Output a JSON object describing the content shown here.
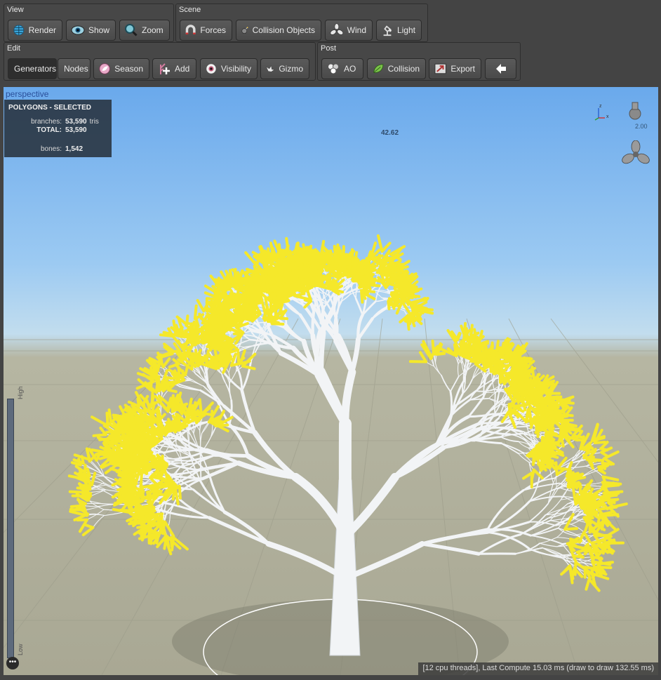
{
  "toolbar": {
    "view": {
      "title": "View",
      "render": "Render",
      "show": "Show",
      "zoom": "Zoom"
    },
    "scene": {
      "title": "Scene",
      "forces": "Forces",
      "collision_objects": "Collision Objects",
      "wind": "Wind",
      "light": "Light"
    },
    "edit": {
      "title": "Edit",
      "generators": "Generators",
      "nodes": "Nodes",
      "season": "Season",
      "add": "Add",
      "visibility": "Visibility",
      "gizmo": "Gizmo"
    },
    "post": {
      "title": "Post",
      "ao": "AO",
      "collision": "Collision",
      "export": "Export"
    }
  },
  "viewport": {
    "label": "perspective",
    "fps": "42.62",
    "zoom": "2.00",
    "axis_z": "z",
    "axis_x": "x",
    "lod_high": "High",
    "lod_low": "Low",
    "more": "•••",
    "stats": {
      "heading": "POLYGONS - SELECTED",
      "branches_label": "branches:",
      "branches_value": "53,590",
      "branches_unit": "tris",
      "total_label": "TOTAL:",
      "total_value": "53,590",
      "bones_label": "bones:",
      "bones_value": "1,542"
    },
    "status": "[12 cpu threads], Last Compute 15.03 ms (draw to draw 132.55 ms)"
  },
  "colors": {
    "selection": "#f5e82a",
    "sky": "#7db7f0",
    "ground": "#aeae9a",
    "branch": "#f2f4f6"
  },
  "icons": [
    "globe-icon",
    "eye-icon",
    "magnifier-icon",
    "magnet-icon",
    "bomb-icon",
    "fan-icon",
    "lamp-icon",
    "leaf-icon",
    "plus-icon",
    "eyeball-icon",
    "bird-icon",
    "ao-icon",
    "leaf-collision-icon",
    "export-icon",
    "back-arrow-icon",
    "propeller-icon",
    "light-bulb-icon"
  ]
}
